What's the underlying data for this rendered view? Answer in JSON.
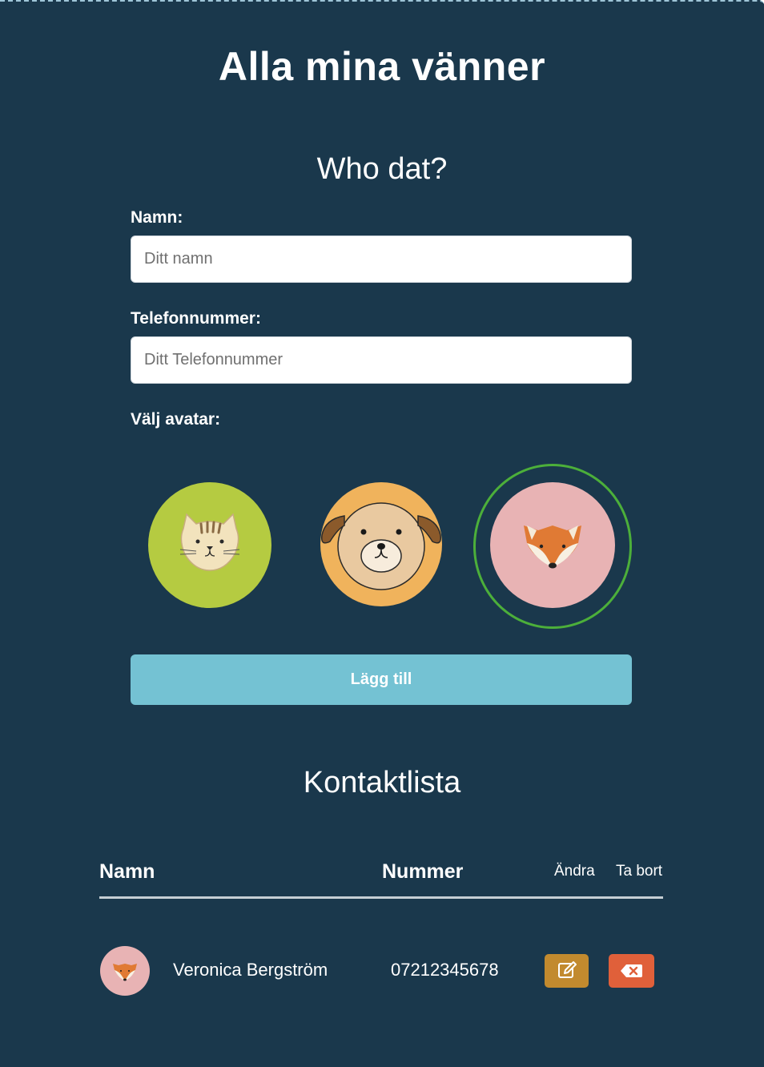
{
  "app": {
    "title": "Alla mina vänner"
  },
  "form": {
    "title": "Who dat?",
    "name_label": "Namn:",
    "name_placeholder": "Ditt namn",
    "name_value": "",
    "phone_label": "Telefonnummer:",
    "phone_placeholder": "Ditt Telefonnummer",
    "phone_value": "",
    "avatar_label": "Välj avatar:",
    "avatars": [
      {
        "icon": "cat-icon",
        "color": "#b5cb41",
        "selected": false
      },
      {
        "icon": "dog-icon",
        "color": "#f0b35c",
        "selected": false
      },
      {
        "icon": "fox-icon",
        "color": "#e8b3b4",
        "selected": true
      }
    ],
    "submit_label": "Lägg till"
  },
  "contacts": {
    "title": "Kontaktlista",
    "headers": {
      "name": "Namn",
      "number": "Nummer",
      "edit": "Ändra",
      "delete": "Ta bort"
    },
    "rows": [
      {
        "avatar_icon": "fox-icon",
        "name": "Veronica Bergström",
        "number": "07212345678",
        "edit_icon": "edit-icon",
        "delete_icon": "delete-icon"
      }
    ]
  },
  "colors": {
    "background": "#1a384c",
    "primary_button": "#74c2d3",
    "edit_button": "#c28a2e",
    "delete_button": "#e0603a",
    "selected_ring": "#4caf3a"
  }
}
